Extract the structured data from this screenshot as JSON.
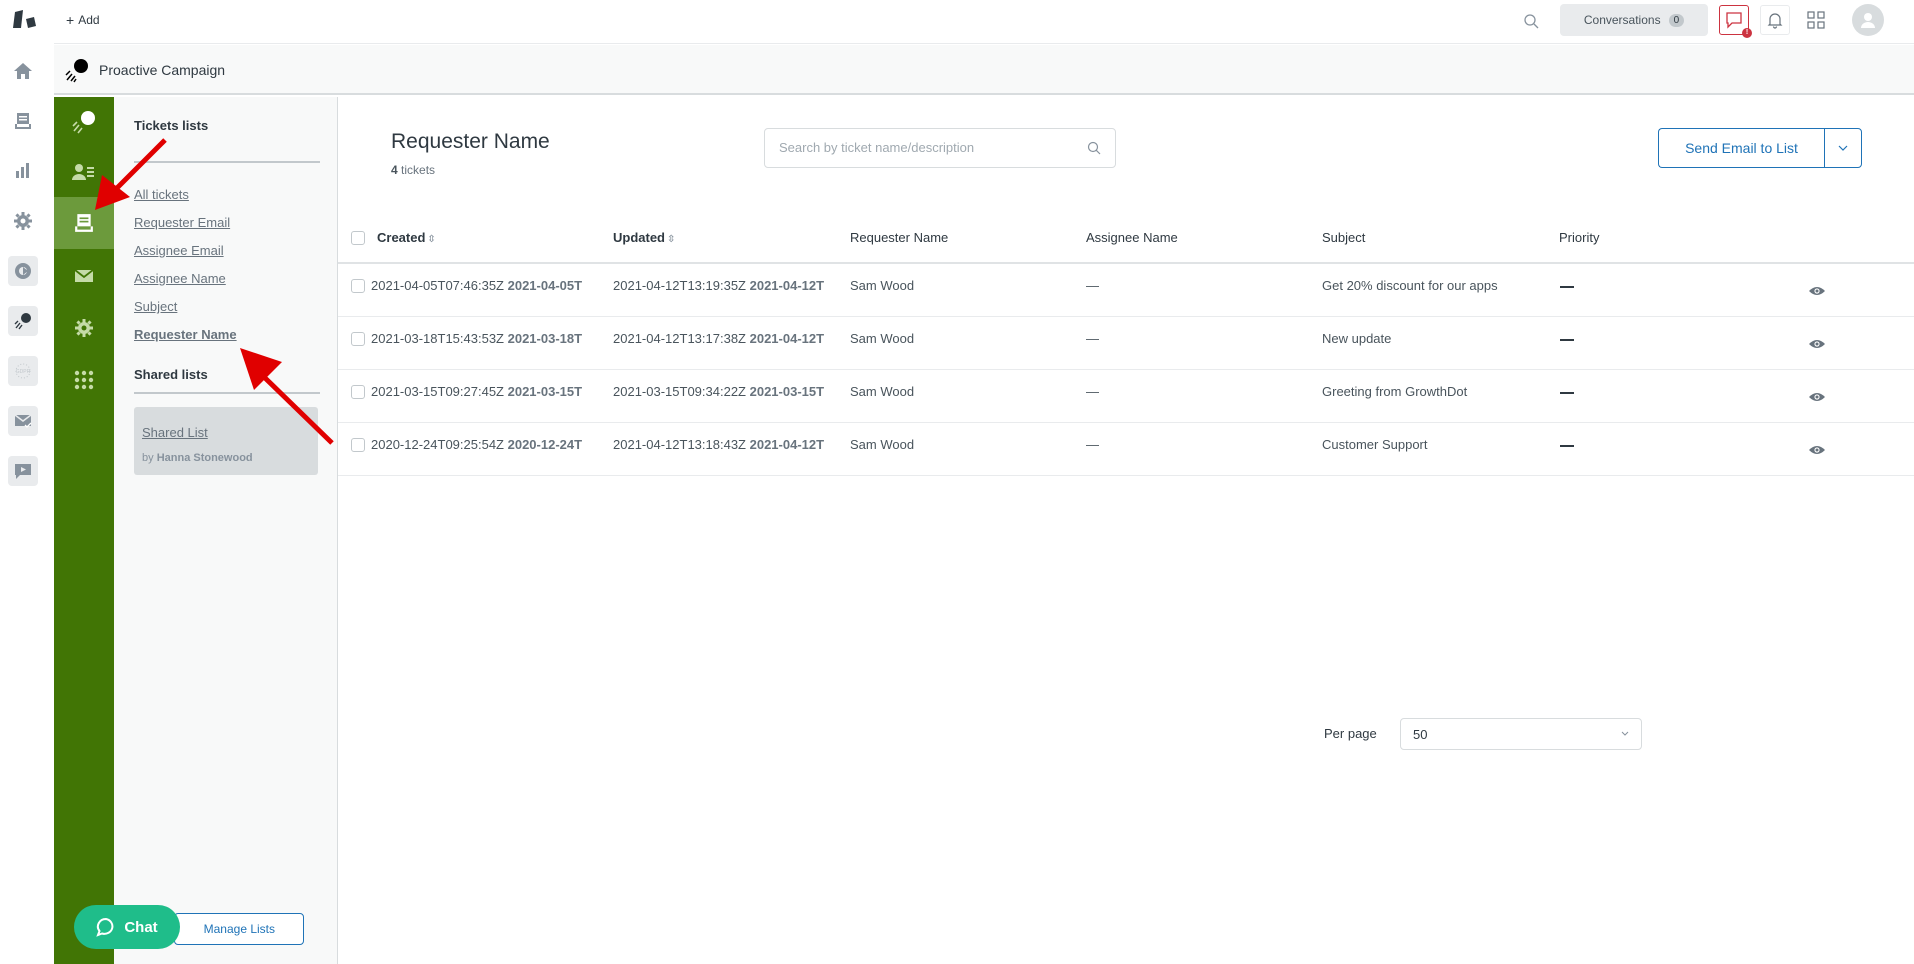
{
  "topbar": {
    "add_label": "Add",
    "conversations_label": "Conversations",
    "conversations_count": "0",
    "chat_badge": "!"
  },
  "rail": {
    "items": [
      "home-icon",
      "tickets-icon",
      "reporting-icon",
      "admin-icon",
      "app-icon",
      "proactive-campaign-icon",
      "gdpr-icon",
      "email-app-icon",
      "video-app-icon"
    ]
  },
  "app": {
    "title": "Proactive Campaign",
    "sidebar_icons": [
      "campaign-icon",
      "contacts-icon",
      "ticket-lists-icon",
      "email-icon",
      "settings-icon",
      "apps-grid-icon"
    ],
    "active_sidebar_index": 2
  },
  "lists_panel": {
    "tickets_lists_title": "Tickets lists",
    "ticket_lists": [
      {
        "label": "All tickets",
        "current": false
      },
      {
        "label": "Requester Email",
        "current": false
      },
      {
        "label": "Assignee Email",
        "current": false
      },
      {
        "label": "Assignee Name",
        "current": false
      },
      {
        "label": "Subject",
        "current": false
      },
      {
        "label": "Requester Name",
        "current": true
      }
    ],
    "shared_lists_title": "Shared lists",
    "shared_list": {
      "name": "Shared List",
      "by_prefix": "by",
      "author": "Hanna Stonewood"
    },
    "manage_lists_label": "Manage Lists"
  },
  "chat_widget": {
    "label": "Chat"
  },
  "main": {
    "title": "Requester Name",
    "ticket_count": "4",
    "ticket_count_suffix": "tickets",
    "search_placeholder": "Search by ticket name/description",
    "search_value": "",
    "send_email_label": "Send Email to List"
  },
  "table": {
    "columns": [
      {
        "label": "Created",
        "sortable": true
      },
      {
        "label": "Updated",
        "sortable": true
      },
      {
        "label": "Requester Name",
        "sortable": false
      },
      {
        "label": "Assignee Name",
        "sortable": false
      },
      {
        "label": "Subject",
        "sortable": false
      },
      {
        "label": "Priority",
        "sortable": false
      }
    ],
    "rows": [
      {
        "created": "2021-04-05T07:46:35Z",
        "created_bold": "2021-04-05T",
        "updated": "2021-04-12T13:19:35Z",
        "updated_bold": "2021-04-12T",
        "requester": "Sam Wood",
        "assignee": "—",
        "subject": "Get 20% discount for our apps",
        "priority": "—"
      },
      {
        "created": "2021-03-18T15:43:53Z",
        "created_bold": "2021-03-18T",
        "updated": "2021-04-12T13:17:38Z",
        "updated_bold": "2021-04-12T",
        "requester": "Sam Wood",
        "assignee": "—",
        "subject": "New update",
        "priority": "—"
      },
      {
        "created": "2021-03-15T09:27:45Z",
        "created_bold": "2021-03-15T",
        "updated": "2021-03-15T09:34:22Z",
        "updated_bold": "2021-03-15T",
        "requester": "Sam Wood",
        "assignee": "—",
        "subject": "Greeting from GrowthDot",
        "priority": "—"
      },
      {
        "created": "2020-12-24T09:25:54Z",
        "created_bold": "2020-12-24T",
        "updated": "2021-04-12T13:18:43Z",
        "updated_bold": "2021-04-12T",
        "requester": "Sam Wood",
        "assignee": "—",
        "subject": "Customer Support",
        "priority": "—"
      }
    ]
  },
  "pagination": {
    "per_page_label": "Per page",
    "per_page_value": "50"
  },
  "colors": {
    "brand_green": "#417505",
    "active_green": "#6c9a3c",
    "primary_blue": "#1f73b7",
    "chat_green": "#1fbd8a",
    "alert_red": "#cc3340",
    "annotation_red": "#e00000"
  }
}
